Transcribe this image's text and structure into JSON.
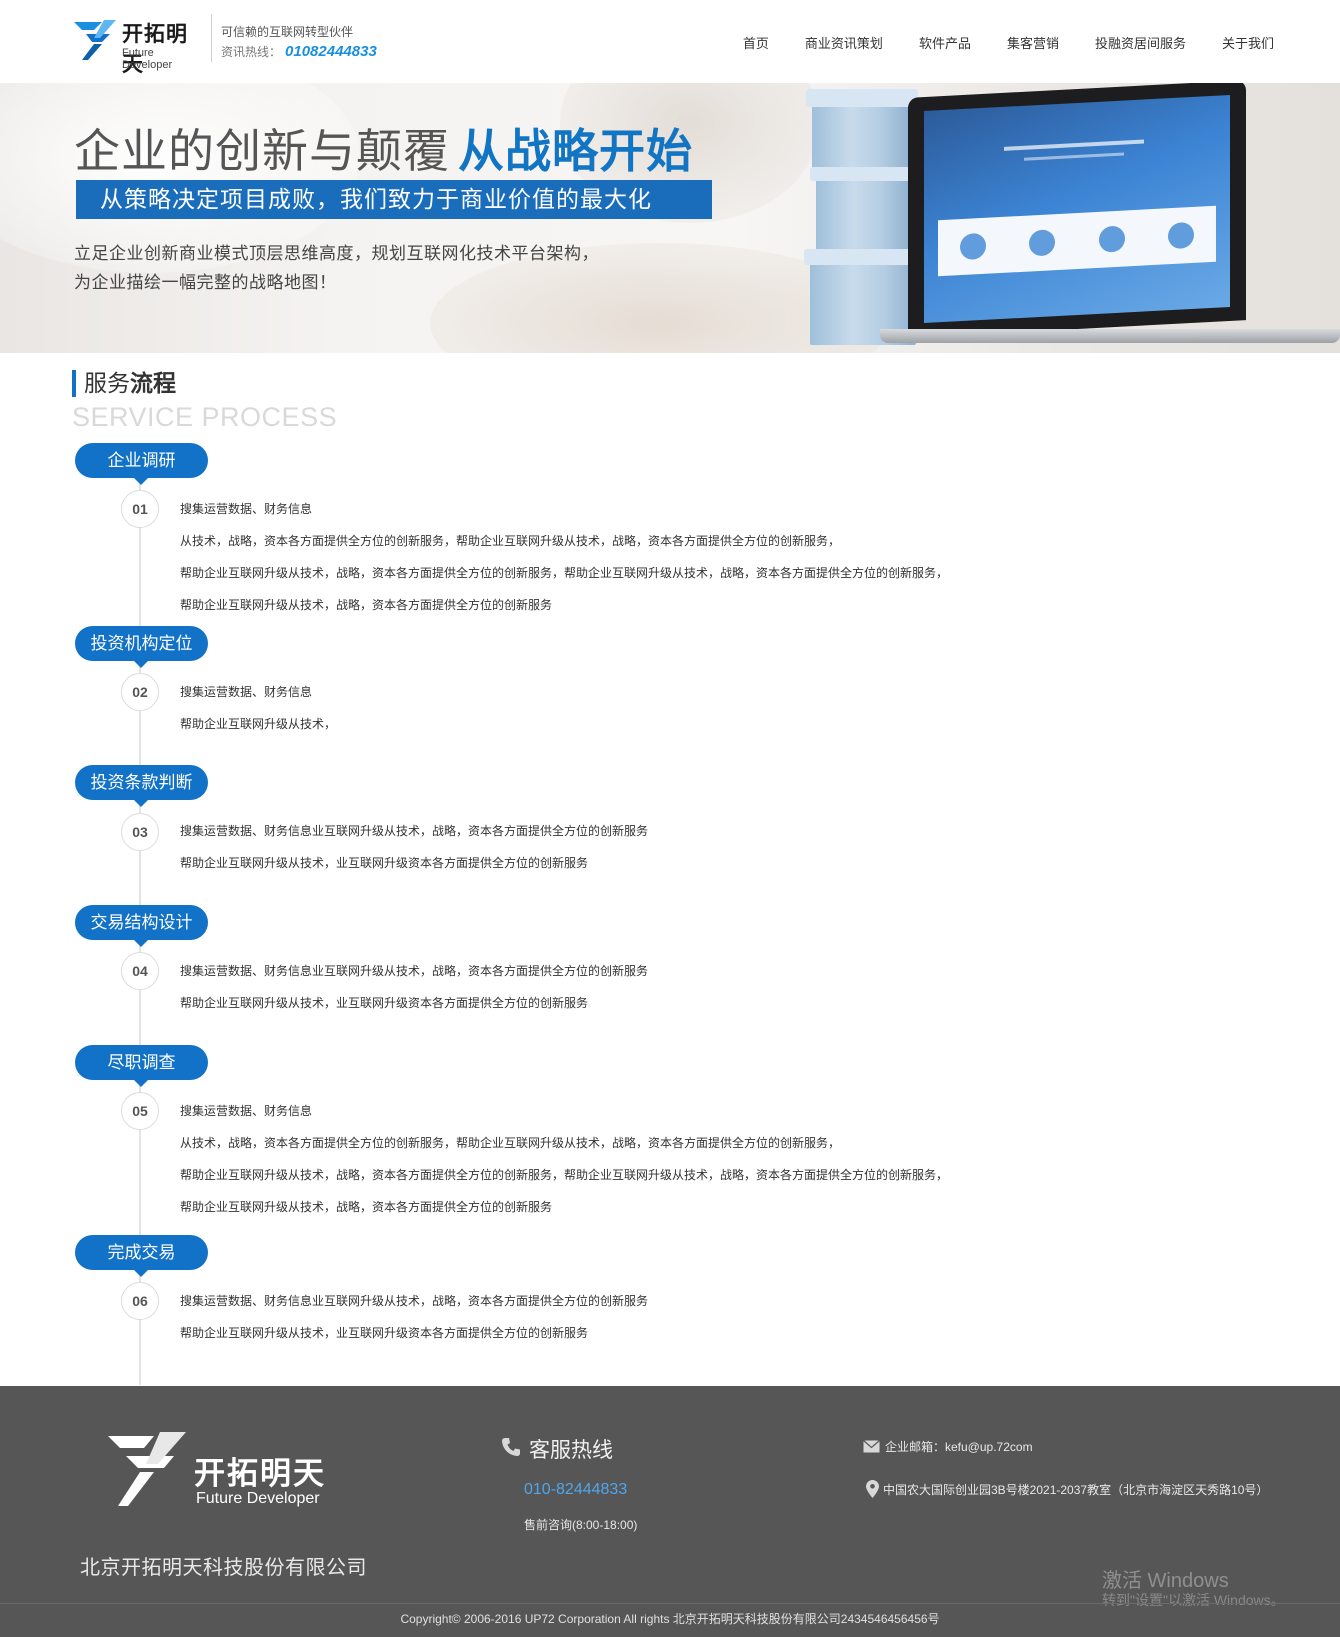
{
  "header": {
    "logo_cn": "开拓明天",
    "logo_en": "Future Developer",
    "tagline": "可信赖的互联网转型伙伴",
    "hotline_label": "资讯热线：",
    "hotline_number": "01082444833",
    "nav": [
      "首页",
      "商业资讯策划",
      "软件产品",
      "集客营销",
      "投融资居间服务",
      "关于我们"
    ]
  },
  "banner": {
    "title_main": "企业的创新与颠覆",
    "title_highlight": "从战略开始",
    "subtitle": "从策略决定项目成败，我们致力于商业价值的最大化",
    "desc_line1": "立足企业创新商业模式顶层思维高度，规划互联网化技术平台架构，",
    "desc_line2": "为企业描绘一幅完整的战略地图！"
  },
  "section": {
    "title_prefix": "服务",
    "title_bold": "流程",
    "subtitle_en": "SERVICE PROCESS"
  },
  "stages": [
    {
      "label": "企业调研",
      "number": "01",
      "lines": [
        "搜集运营数据、财务信息",
        "从技术，战略，资本各方面提供全方位的创新服务，帮助企业互联网升级从技术，战略，资本各方面提供全方位的创新服务，",
        "帮助企业互联网升级从技术，战略，资本各方面提供全方位的创新服务，帮助企业互联网升级从技术，战略，资本各方面提供全方位的创新服务，",
        "帮助企业互联网升级从技术，战略，资本各方面提供全方位的创新服务"
      ]
    },
    {
      "label": "投资机构定位",
      "number": "02",
      "lines": [
        "搜集运营数据、财务信息",
        "帮助企业互联网升级从技术，"
      ]
    },
    {
      "label": "投资条款判断",
      "number": "03",
      "lines": [
        "搜集运营数据、财务信息业互联网升级从技术，战略，资本各方面提供全方位的创新服务",
        "帮助企业互联网升级从技术，业互联网升级资本各方面提供全方位的创新服务"
      ]
    },
    {
      "label": "交易结构设计",
      "number": "04",
      "lines": [
        "搜集运营数据、财务信息业互联网升级从技术，战略，资本各方面提供全方位的创新服务",
        "帮助企业互联网升级从技术，业互联网升级资本各方面提供全方位的创新服务"
      ]
    },
    {
      "label": "尽职调查",
      "number": "05",
      "lines": [
        "搜集运营数据、财务信息",
        "从技术，战略，资本各方面提供全方位的创新服务，帮助企业互联网升级从技术，战略，资本各方面提供全方位的创新服务，",
        "帮助企业互联网升级从技术，战略，资本各方面提供全方位的创新服务，帮助企业互联网升级从技术，战略，资本各方面提供全方位的创新服务，",
        "帮助企业互联网升级从技术，战略，资本各方面提供全方位的创新服务"
      ]
    },
    {
      "label": "完成交易",
      "number": "06",
      "lines": [
        "搜集运营数据、财务信息业互联网升级从技术，战略，资本各方面提供全方位的创新服务",
        "帮助企业互联网升级从技术，业互联网升级资本各方面提供全方位的创新服务"
      ]
    }
  ],
  "footer": {
    "logo_cn": "开拓明天",
    "logo_en": "Future Developer",
    "company": "北京开拓明天科技股份有限公司",
    "hotline_title": "客服热线",
    "hotline_number": "010-82444833",
    "hotline_hours": "售前咨询(8:00-18:00)",
    "email": "企业邮箱：kefu@up.72com",
    "address": "中国农大国际创业园3B号楼2021-2037教室（北京市海淀区天秀路10号）",
    "windows_line1": "激活 Windows",
    "windows_line2": "转到\"设置\"以激活 Windows。",
    "copyright": "Copyright© 2006-2016 UP72 Corporation All rights 北京开拓明天科技股份有限公司2434546456456号"
  },
  "colors": {
    "brand_blue": "#1272c7",
    "link_blue": "#1a8fe0",
    "footer_bg": "#565656"
  },
  "icons": {
    "logo": "logo-icon",
    "phone": "phone-icon",
    "mail": "mail-icon",
    "location": "location-pin-icon"
  }
}
